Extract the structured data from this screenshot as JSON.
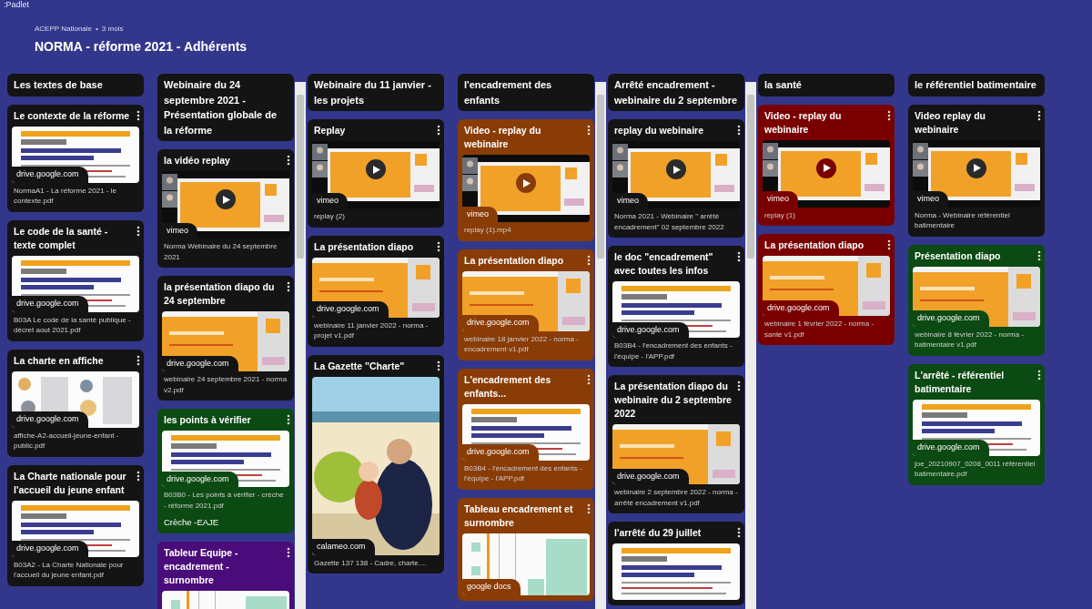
{
  "app": {
    "brand": ":Padlet"
  },
  "header": {
    "author": "ACEPP Nationale",
    "separator": "•",
    "age": "3 mois",
    "title": "NORMA - réforme 2021 - Adhérents"
  },
  "columns": [
    {
      "title": "Les textes de base",
      "scrollbar": false,
      "cards": [
        {
          "title": "Le contexte de la réforme",
          "color": "#141414",
          "kind": "doc",
          "source": "drive.google.com",
          "caption": "NormaA1 - La réforme 2021 - le contexte.pdf"
        },
        {
          "title": "Le code de la santé - texte complet",
          "color": "#141414",
          "kind": "doc",
          "source": "drive.google.com",
          "caption": "B03A Le code de la santé publique - décret aout 2021.pdf"
        },
        {
          "title": "La charte en affiche",
          "color": "#141414",
          "kind": "poster",
          "source": "drive.google.com",
          "caption": "affiche-A2-accueil-jeune-enfant - public.pdf"
        },
        {
          "title": "La Charte nationale pour l'accueil du jeune enfant",
          "color": "#141414",
          "kind": "doc",
          "source": "drive.google.com",
          "caption": "B03A2 - La Charte Nationale pour l'accueil du jeune enfant.pdf"
        }
      ]
    },
    {
      "title": "Webinaire du 24 septembre 2021 - Présentation globale de la réforme",
      "scrollbar": true,
      "cards": [
        {
          "title": "la vidéo replay",
          "color": "#141414",
          "kind": "video",
          "source": "vimeo",
          "caption": "Norma Webinaire du 24 septembre 2021"
        },
        {
          "title": "la présentation diapo du 24 septembre",
          "color": "#141414",
          "kind": "slide",
          "source": "drive.google.com",
          "caption": "webinaire 24 septembre 2021 - norma v2.pdf"
        },
        {
          "title": "les points à vérifier",
          "color": "#0b4a12",
          "kind": "doc",
          "source": "drive.google.com",
          "caption": "B03B0 - Les points à vérifier - crèche - réforme 2021.pdf",
          "note": "Crèche -EAJE"
        },
        {
          "title": "Tableur Equipe - encadrement - surnombre",
          "color": "#4a0c7a",
          "kind": "sheet"
        }
      ]
    },
    {
      "title": "Webinaire du 11 janvier - les projets",
      "scrollbar": false,
      "cards": [
        {
          "title": "Replay",
          "color": "#141414",
          "kind": "video",
          "source": "vimeo",
          "caption": "replay (2)"
        },
        {
          "title": "La présentation diapo",
          "color": "#141414",
          "kind": "slide",
          "source": "drive.google.com",
          "caption": "webinaire 11 janvier 2022 - norma -projet v1.pdf"
        },
        {
          "title": "La Gazette \"Charte\"",
          "color": "#141414",
          "kind": "cover",
          "source": "calameo.com",
          "caption": "Gazette 137 138 - Cadre, charte...."
        }
      ]
    },
    {
      "title": "l'encadrement des enfants",
      "scrollbar": true,
      "cards": [
        {
          "title": "Video - replay du webinaire",
          "color": "#8a3c06",
          "kind": "video",
          "source": "vimeo",
          "caption": "replay (1).mp4"
        },
        {
          "title": "La présentation diapo",
          "color": "#8a3c06",
          "kind": "slide",
          "source": "drive.google.com",
          "caption": "webinaire 18 janvier 2022 - norma -encadrement v1.pdf"
        },
        {
          "title": "L'encadrement des enfants...",
          "color": "#8a3c06",
          "kind": "doc",
          "source": "drive.google.com",
          "caption": "B03B4 - l'encadrement des enfants - l'équipe - l'APP.pdf"
        },
        {
          "title": "Tableau encadrement et surnombre",
          "color": "#8a3c06",
          "kind": "sheet",
          "source": "google docs"
        }
      ]
    },
    {
      "title": "Arrêté encadrement - webinaire du 2 septembre",
      "scrollbar": true,
      "cards": [
        {
          "title": "replay du webinaire",
          "color": "#141414",
          "kind": "video",
          "source": "vimeo",
          "caption": "Norma 2021 - Webinaire \" arrêté encadrement\" 02 septembre 2022"
        },
        {
          "title": "le doc \"encadrement\" avec toutes les infos",
          "color": "#141414",
          "kind": "doc",
          "source": "drive.google.com",
          "caption": "B03B4 - l'encadrement des enfants - l'équipe - l'APP.pdf"
        },
        {
          "title": "La présentation diapo du webinaire du 2 septembre 2022",
          "color": "#141414",
          "kind": "slide",
          "source": "drive.google.com",
          "caption": "webinaire 2 septembre 2022 - norma - arrêté encadrement v1.pdf"
        },
        {
          "title": "l'arrêté du 29 juillet",
          "color": "#141414",
          "kind": "doc"
        }
      ]
    },
    {
      "title": "la santé",
      "scrollbar": false,
      "cards": [
        {
          "title": "Video - replay du webinaire",
          "color": "#7a0000",
          "kind": "video",
          "source": "vimeo",
          "caption": "replay (1)"
        },
        {
          "title": "La présentation diapo",
          "color": "#7a0000",
          "kind": "slide",
          "source": "drive.google.com",
          "caption": "webinaire 1 février 2022 - norma -santé v1.pdf"
        }
      ]
    },
    {
      "title": "le référentiel batimentaire",
      "scrollbar": false,
      "cards": [
        {
          "title": "Video replay du webinaire",
          "color": "#141414",
          "kind": "video",
          "source": "vimeo",
          "caption": "Norma - Webinaire référentiel batimentaire"
        },
        {
          "title": "Présentation diapo",
          "color": "#0b4a12",
          "kind": "slide",
          "source": "drive.google.com",
          "caption": "webinaire 8 février 2022 - norma -batimentaire v1.pdf"
        },
        {
          "title": "L'arrêté - référentiel batimentaire",
          "color": "#0b4a12",
          "kind": "doc",
          "source": "drive.google.com",
          "caption": "joe_20210907_0208_0011 référentiel batimentaire.pdf"
        }
      ]
    }
  ]
}
